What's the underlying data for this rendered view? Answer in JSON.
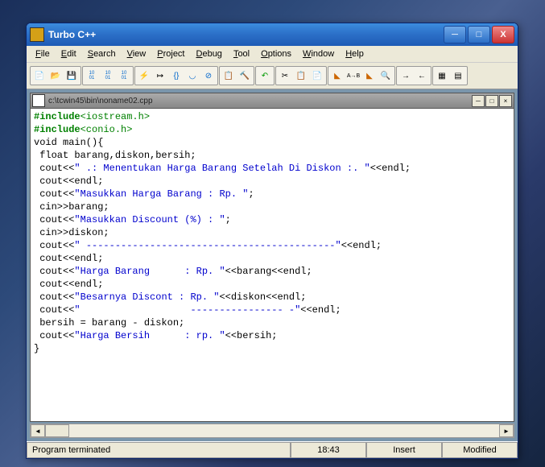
{
  "title": "Turbo C++",
  "menu": [
    "File",
    "Edit",
    "Search",
    "View",
    "Project",
    "Debug",
    "Tool",
    "Options",
    "Window",
    "Help"
  ],
  "doc_title": "c:\\tcwin45\\bin\\noname02.cpp",
  "code": {
    "l1a": "#include",
    "l1b": "<iostream.h>",
    "l2a": "#include",
    "l2b": "<conio.h>",
    "l3": "void main(){",
    "l4": " float barang,diskon,bersih;",
    "l5a": " cout<<",
    "l5b": "\" .: Menentukan Harga Barang Setelah Di Diskon :. \"",
    "l5c": "<<endl;",
    "l6": " cout<<endl;",
    "l7a": " cout<<",
    "l7b": "\"Masukkan Harga Barang : Rp. \"",
    "l7c": ";",
    "l8": " cin>>barang;",
    "l9a": " cout<<",
    "l9b": "\"Masukkan Discount (%) : \"",
    "l9c": ";",
    "l10": " cin>>diskon;",
    "l11a": " cout<<",
    "l11b": "\" -------------------------------------------\"",
    "l11c": "<<endl;",
    "l12": " cout<<endl;",
    "l13a": " cout<<",
    "l13b": "\"Harga Barang      : Rp. \"",
    "l13c": "<<barang<<endl;",
    "l14": " cout<<endl;",
    "l15a": " cout<<",
    "l15b": "\"Besarnya Discont : Rp. \"",
    "l15c": "<<diskon<<endl;",
    "l16a": " cout<<",
    "l16b": "\"                   ---------------- -\"",
    "l16c": "<<endl;",
    "l17": " bersih = barang - diskon;",
    "l18a": " cout<<",
    "l18b": "\"Harga Bersih      : rp. \"",
    "l18c": "<<bersih;",
    "l19": "}"
  },
  "status": {
    "msg": "Program terminated",
    "pos": "18:43",
    "mode": "Insert",
    "state": "Modified"
  }
}
